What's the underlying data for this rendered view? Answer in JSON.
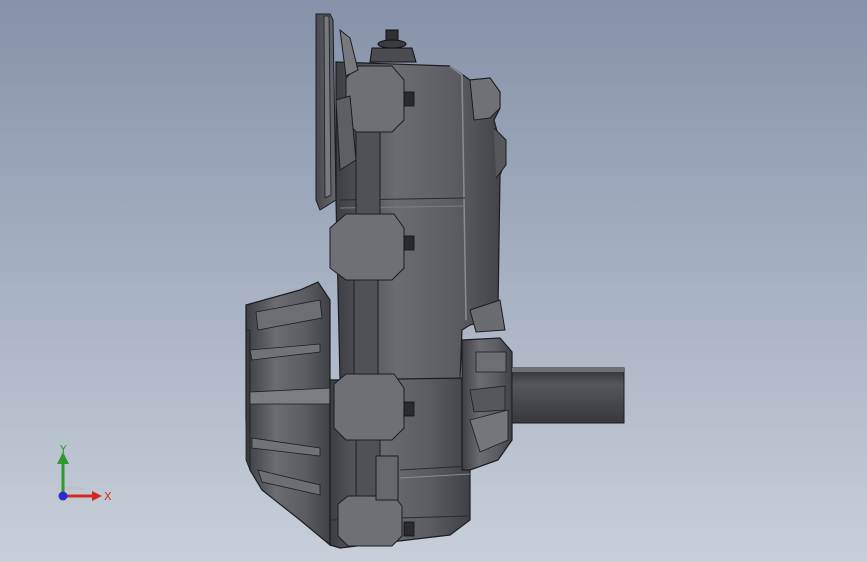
{
  "viewport": {
    "background_top": "#8592a9",
    "background_bottom": "#c8cfd9",
    "model_color": "#5a5c62"
  },
  "triad": {
    "x_label": "X",
    "y_label": "Y",
    "x_color": "#d42a1e",
    "y_color": "#2e9a2e",
    "z_color": "#2a2ad0"
  }
}
